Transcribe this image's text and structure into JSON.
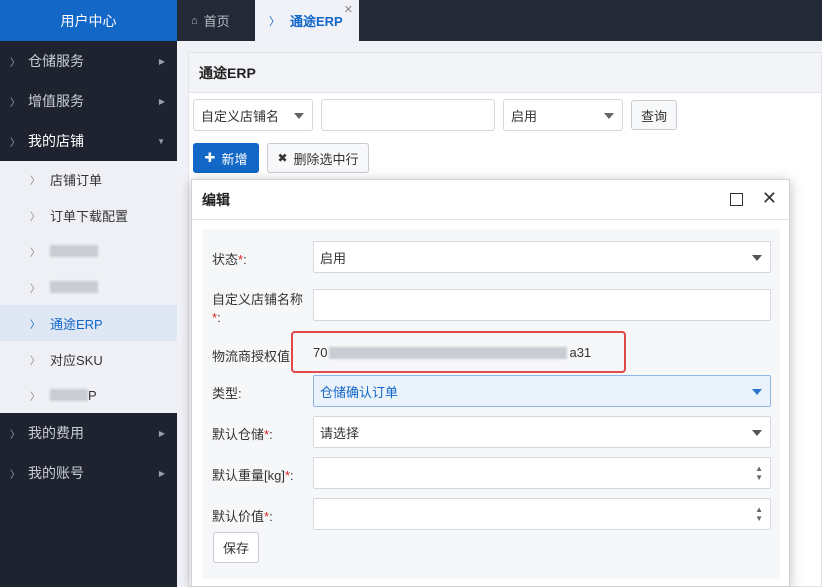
{
  "sidebar": {
    "brand": "用户中心",
    "items": [
      {
        "label": "仓储服务"
      },
      {
        "label": "增值服务"
      },
      {
        "label": "我的店铺"
      },
      {
        "label": "我的费用"
      },
      {
        "label": "我的账号"
      }
    ],
    "subitems": [
      {
        "label": "店铺订单"
      },
      {
        "label": "订单下载配置"
      },
      {
        "label": ""
      },
      {
        "label": ""
      },
      {
        "label": "通途ERP"
      },
      {
        "label": "对应SKU"
      },
      {
        "label": "P"
      }
    ]
  },
  "tabs": [
    {
      "label": "首页"
    },
    {
      "label": "通途ERP"
    }
  ],
  "panel": {
    "title": "通途ERP",
    "filter_select": "自定义店铺名",
    "status_select": "启用",
    "query_label": "查询",
    "add_label": "新增",
    "delete_label": "删除选中行"
  },
  "dialog": {
    "title": "编辑",
    "fields": {
      "status_label": "状态",
      "status_value": "启用",
      "shop_name_label": "自定义店铺名称",
      "auth_label": "物流商授权值:",
      "auth_prefix": "70",
      "auth_suffix": "a31",
      "type_label": "类型:",
      "type_value": "仓储确认订单",
      "warehouse_label": "默认仓储",
      "warehouse_value": "请选择",
      "weight_label": "默认重量[kg]",
      "value_label": "默认价值"
    },
    "required_mark": "*",
    "colon": ":",
    "save_label": "保存"
  },
  "colors": {
    "accent": "#1367c6",
    "sidebar_bg": "#1f2330",
    "highlight_box": "#e04a4a",
    "required": "#d9251d"
  }
}
